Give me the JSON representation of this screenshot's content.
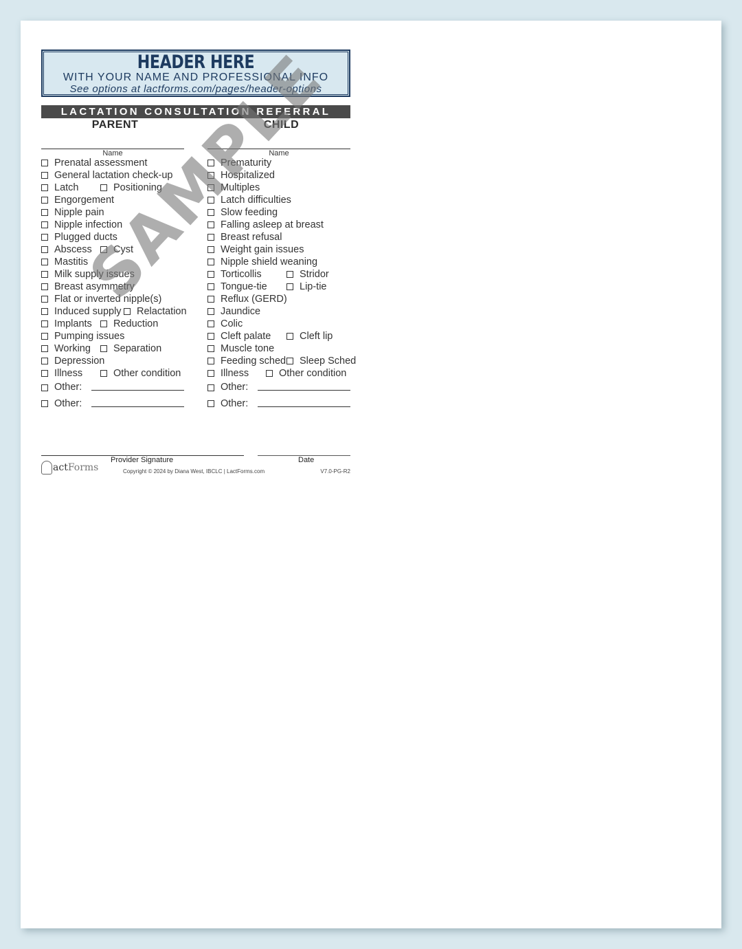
{
  "header": {
    "title": "HEADER HERE",
    "subtitle": "WITH YOUR NAME AND PROFESSIONAL INFO",
    "link_text": "See options at lactforms.com/pages/header-options"
  },
  "form_title": "LACTATION CONSULTATION REFERRAL",
  "parent": {
    "heading": "PARENT",
    "name_label": "Name",
    "rows": [
      [
        {
          "label": "Prenatal assessment"
        }
      ],
      [
        {
          "label": "General lactation check-up"
        }
      ],
      [
        {
          "label": "Latch"
        },
        {
          "label": "Positioning"
        }
      ],
      [
        {
          "label": "Engorgement"
        }
      ],
      [
        {
          "label": "Nipple pain"
        }
      ],
      [
        {
          "label": "Nipple infection"
        }
      ],
      [
        {
          "label": "Plugged ducts"
        }
      ],
      [
        {
          "label": "Abscess"
        },
        {
          "label": "Cyst"
        }
      ],
      [
        {
          "label": "Mastitis"
        }
      ],
      [
        {
          "label": "Milk supply issues"
        }
      ],
      [
        {
          "label": "Breast asymmetry"
        }
      ],
      [
        {
          "label": "Flat or inverted nipple(s)"
        }
      ],
      [
        {
          "label": "Induced supply"
        },
        {
          "label": "Relactation"
        }
      ],
      [
        {
          "label": "Implants"
        },
        {
          "label": "Reduction"
        }
      ],
      [
        {
          "label": "Pumping issues"
        }
      ],
      [
        {
          "label": "Working"
        },
        {
          "label": "Separation"
        }
      ],
      [
        {
          "label": "Depression"
        }
      ],
      [
        {
          "label": "Illness"
        },
        {
          "label": "Other condition"
        }
      ]
    ],
    "other_rows": [
      "Other:",
      "Other:"
    ]
  },
  "child": {
    "heading": "CHILD",
    "name_label": "Name",
    "rows": [
      [
        {
          "label": "Prematurity"
        }
      ],
      [
        {
          "label": "Hospitalized"
        }
      ],
      [
        {
          "label": "Multiples"
        }
      ],
      [
        {
          "label": "Latch difficulties"
        }
      ],
      [
        {
          "label": "Slow feeding"
        }
      ],
      [
        {
          "label": "Falling asleep at breast"
        }
      ],
      [
        {
          "label": "Breast refusal"
        }
      ],
      [
        {
          "label": "Weight gain issues"
        }
      ],
      [
        {
          "label": "Nipple shield weaning"
        }
      ],
      [
        {
          "label": "Torticollis"
        },
        {
          "label": "Stridor"
        }
      ],
      [
        {
          "label": "Tongue-tie"
        },
        {
          "label": "Lip-tie"
        }
      ],
      [
        {
          "label": "Reflux (GERD)"
        }
      ],
      [
        {
          "label": "Jaundice"
        }
      ],
      [
        {
          "label": "Colic"
        }
      ],
      [
        {
          "label": "Cleft palate"
        },
        {
          "label": "Cleft lip"
        }
      ],
      [
        {
          "label": "Muscle tone"
        }
      ],
      [
        {
          "label": "Feeding sched"
        },
        {
          "label": "Sleep Sched"
        }
      ],
      [
        {
          "label": "Illness"
        },
        {
          "label": "Other condition"
        }
      ]
    ],
    "other_rows": [
      "Other:",
      "Other:"
    ]
  },
  "footer": {
    "signature_label": "Provider Signature",
    "date_label": "Date",
    "logo_text_main": "act",
    "logo_text_accent": "Forms",
    "copyright": "Copyright © 2024 by Diana West, IBCLC  |  LactForms.com",
    "version": "V7.0-PG-R2"
  },
  "watermark": "SAMPLE"
}
